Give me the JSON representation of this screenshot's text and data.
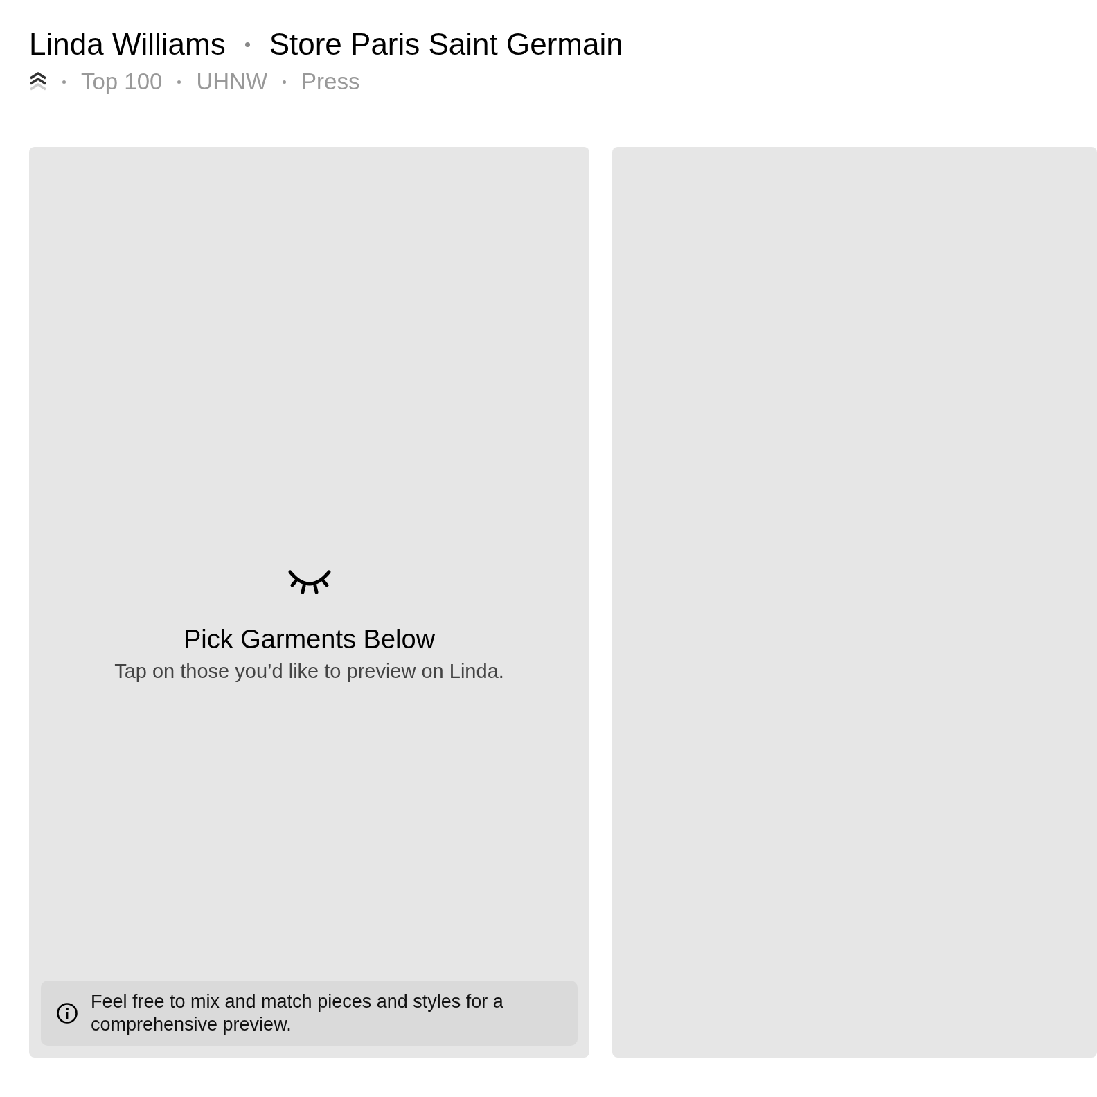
{
  "header": {
    "client_name": "Linda Williams",
    "store": "Store Paris Saint Germain",
    "tags": [
      "Top 100",
      "UHNW",
      "Press"
    ]
  },
  "preview_panel": {
    "title": "Pick Garments Below",
    "subtitle": "Tap on those you’d like to preview on Linda.",
    "tip": "Feel free to mix and match pieces and styles for a comprehensive preview."
  }
}
